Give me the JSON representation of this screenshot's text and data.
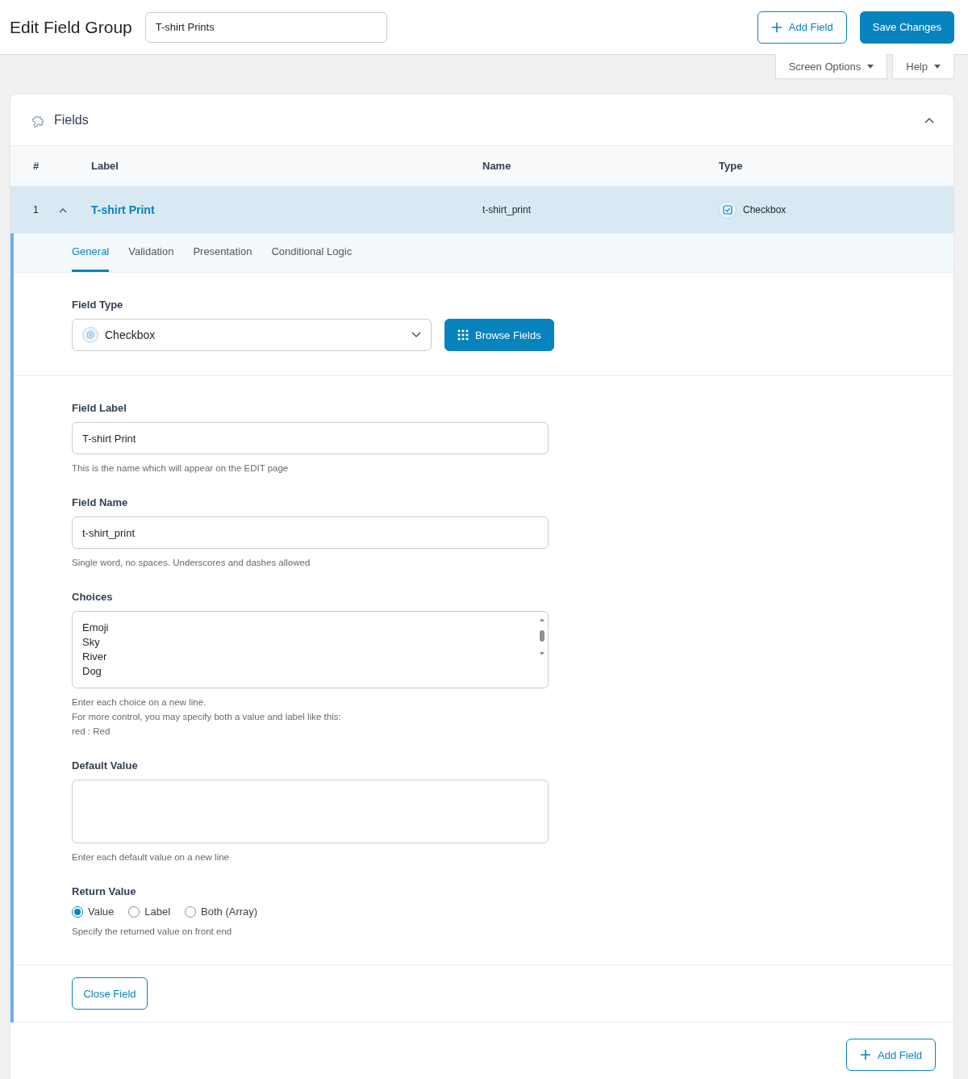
{
  "header": {
    "title": "Edit Field Group",
    "group_name": "T-shirt Prints",
    "add_button": "Add Field",
    "save_button": "Save Changes"
  },
  "screen_meta": [
    {
      "label": "Screen Options"
    },
    {
      "label": "Help"
    }
  ],
  "panel": {
    "title": "Fields",
    "expanded": true
  },
  "table": {
    "columns": [
      "#",
      "Label",
      "Name",
      "Type"
    ],
    "rows": [
      {
        "number": "1",
        "label": "T-shirt Print",
        "name": "t-shirt_print",
        "type": "Checkbox",
        "expanded": true
      }
    ]
  },
  "tabs": [
    {
      "label": "General",
      "selected": true
    },
    {
      "label": "Validation",
      "selected": false
    },
    {
      "label": "Presentation",
      "selected": false
    },
    {
      "label": "Conditional Logic",
      "selected": false
    }
  ],
  "field_type": {
    "label": "Field Type",
    "value": "Checkbox",
    "browse_button": "Browse Fields"
  },
  "settings": [
    {
      "kind": "input",
      "label": "Field Label",
      "value": "T-shirt Print",
      "hints": [
        "This is the name which will appear on the EDIT page"
      ]
    },
    {
      "kind": "input",
      "label": "Field Name",
      "value": "t-shirt_print",
      "hints": [
        "Single word, no spaces. Underscores and dashes allowed"
      ]
    },
    {
      "kind": "textarea",
      "label": "Choices",
      "lines": [
        "Emoji",
        "Sky",
        "River",
        "Dog"
      ],
      "hints": [
        "Enter each choice on a new line.",
        "For more control, you may specify both a value and label like this:",
        "red : Red"
      ]
    },
    {
      "kind": "textarea",
      "label": "Default Value",
      "hints": [
        "Enter each default value on a new line"
      ]
    },
    {
      "kind": "radio",
      "label": "Return Value",
      "options": [
        {
          "label": "Value",
          "selected": true
        },
        {
          "label": "Label",
          "selected": false
        },
        {
          "label": "Both (Array)",
          "selected": false
        }
      ],
      "hints": [
        "Specify the returned value on front end"
      ]
    }
  ],
  "close_button": "Close Field",
  "footer_add_button": "Add Field"
}
